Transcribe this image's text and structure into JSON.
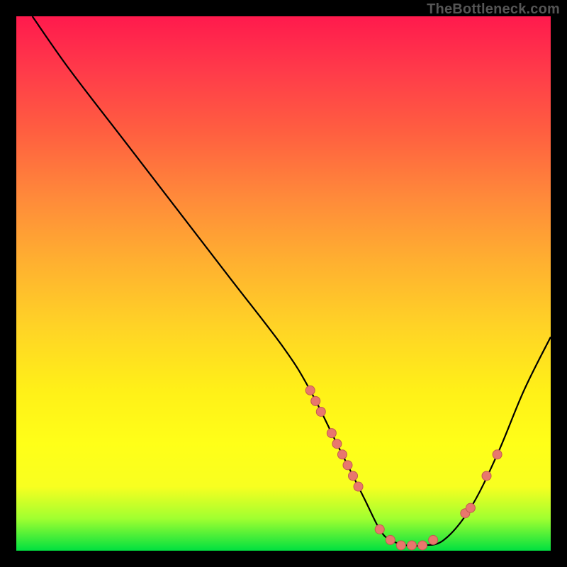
{
  "watermark": "TheBottleneck.com",
  "chart_data": {
    "type": "line",
    "title": "",
    "xlabel": "",
    "ylabel": "",
    "xlim": [
      0,
      100
    ],
    "ylim": [
      0,
      100
    ],
    "series": [
      {
        "name": "curve",
        "x": [
          3,
          10,
          20,
          30,
          40,
          50,
          55,
          60,
          65,
          68,
          70,
          73,
          76,
          80,
          85,
          90,
          95,
          100
        ],
        "values": [
          100,
          90,
          77,
          64,
          51,
          38,
          30,
          20,
          10,
          4,
          2,
          1,
          1,
          2,
          8,
          18,
          30,
          40
        ]
      }
    ],
    "scatter_points": {
      "x": [
        55,
        56,
        57,
        59,
        60,
        61,
        62,
        63,
        64,
        68,
        70,
        72,
        74,
        76,
        78,
        84,
        85,
        88,
        90
      ],
      "values": [
        30,
        28,
        26,
        22,
        20,
        18,
        16,
        14,
        12,
        4,
        2,
        1,
        1,
        1,
        2,
        7,
        8,
        14,
        18
      ]
    }
  },
  "colors": {
    "curve": "#000000",
    "points_fill": "#e8776d",
    "points_stroke": "#c25a50"
  }
}
